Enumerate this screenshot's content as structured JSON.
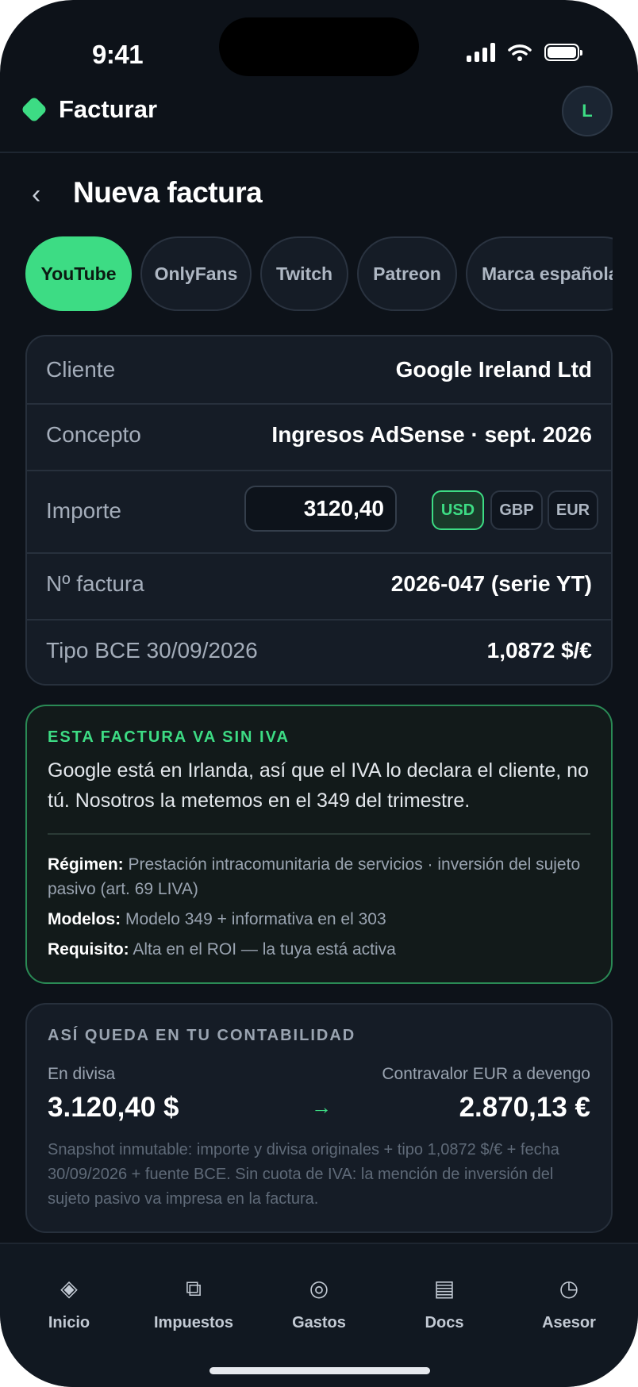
{
  "status_bar": {
    "time": "9:41"
  },
  "header": {
    "app_name": "Facturar",
    "avatar_initial": "L"
  },
  "page": {
    "title": "Nueva factura",
    "back_glyph": "‹"
  },
  "platforms": [
    {
      "label": "YouTube",
      "active": true
    },
    {
      "label": "OnlyFans",
      "active": false
    },
    {
      "label": "Twitch",
      "active": false
    },
    {
      "label": "Patreon",
      "active": false
    },
    {
      "label": "Marca española",
      "active": false
    }
  ],
  "form": {
    "client": {
      "label": "Cliente",
      "value": "Google Ireland Ltd"
    },
    "concept": {
      "label": "Concepto",
      "value": "Ingresos AdSense · sept. 2026"
    },
    "amount": {
      "label": "Importe",
      "value": "3120,40"
    },
    "currencies": [
      {
        "code": "USD",
        "active": true
      },
      {
        "code": "GBP",
        "active": false
      },
      {
        "code": "EUR",
        "active": false
      }
    ],
    "invoice_number": {
      "label": "Nº factura",
      "value": "2026-047 (serie YT)"
    },
    "exchange_rate": {
      "label": "Tipo BCE 30/09/2026",
      "value": "1,0872 $/€"
    }
  },
  "vat_notice": {
    "title": "ESTA FACTURA VA SIN IVA",
    "description": "Google está en Irlanda, así que el IVA lo declara el cliente, no tú. Nosotros la metemos en el 349 del trimestre.",
    "regime_label": "Régimen:",
    "regime_value": "Prestación intracomunitaria de servicios · inversión del sujeto pasivo (art. 69 LIVA)",
    "models_label": "Modelos:",
    "models_value": "Modelo 349 + informativa en el 303",
    "requirement_label": "Requisito:",
    "requirement_value": "Alta en el ROI — la tuya está activa"
  },
  "accounting": {
    "title": "ASÍ QUEDA EN TU CONTABILIDAD",
    "foreign_label": "En divisa",
    "foreign_value": "3.120,40 $",
    "arrow": "→",
    "eur_label": "Contravalor EUR a devengo",
    "eur_value": "2.870,13 €",
    "note": "Snapshot inmutable: importe y divisa originales + tipo 1,0872 $/€ + fecha 30/09/2026 + fuente BCE. Sin cuota de IVA: la mención de inversión del sujeto pasivo va impresa en la factura."
  },
  "tabs": [
    {
      "label": "Inicio",
      "glyph": "◈",
      "icon": "home-diamond-icon"
    },
    {
      "label": "Impuestos",
      "glyph": "⧉",
      "icon": "taxes-icon"
    },
    {
      "label": "Gastos",
      "glyph": "◎",
      "icon": "expenses-icon"
    },
    {
      "label": "Docs",
      "glyph": "▤",
      "icon": "docs-icon"
    },
    {
      "label": "Asesor",
      "glyph": "◷",
      "icon": "advisor-icon"
    }
  ],
  "colors": {
    "accent": "#3ddc84",
    "background": "#0d1219",
    "card": "#151c26"
  }
}
